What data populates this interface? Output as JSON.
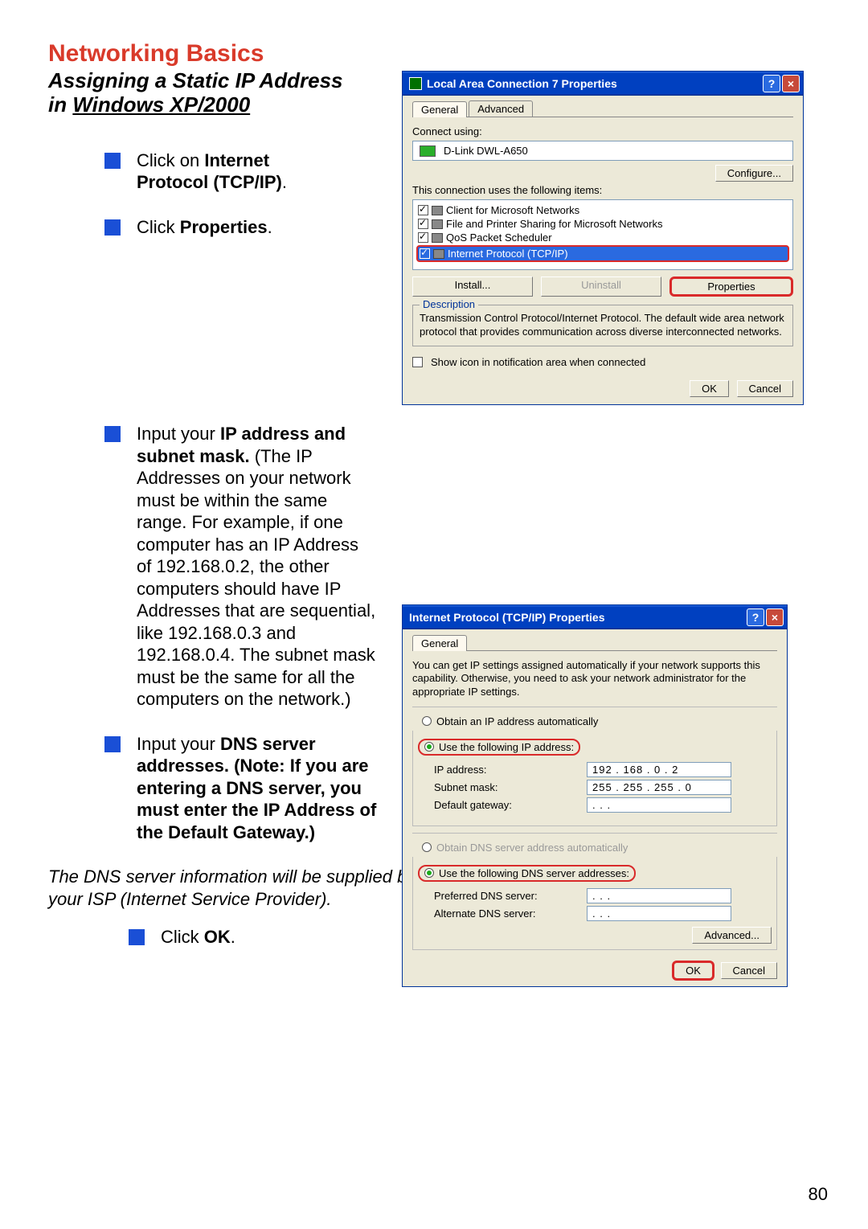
{
  "heading_main": "Networking Basics",
  "heading_sub_line1": "Assigning a Static IP Address",
  "heading_sub_prefix": "in ",
  "heading_sub_underline": "Windows XP/2000",
  "step1_prefix": "Click on ",
  "step1_bold": "Internet Protocol (TCP/IP)",
  "step1_suffix": ".",
  "step2_prefix": "Click ",
  "step2_bold": "Properties",
  "step2_suffix": ".",
  "step3_prefix": "Input your ",
  "step3_bold": "IP address and subnet mask.",
  "step3_rest": " (The IP Addresses on your network must be within the same range. For example, if one computer has an IP Address of 192.168.0.2, the other computers should have IP Addresses that are sequential, like 192.168.0.3 and 192.168.0.4. The subnet mask must be the same for all the computers on the network.)",
  "step4_prefix": "Input your ",
  "step4_bold": "DNS server addresses. (Note:  If you are entering a DNS server, you must enter the IP Address of the Default Gateway.)",
  "dns_note": "The DNS server information will be supplied by your ISP (Internet Service Provider).",
  "step5_prefix": "Click ",
  "step5_bold": "OK",
  "step5_suffix": ".",
  "page_number": "80",
  "dlg1": {
    "title": "Local Area Connection 7 Properties",
    "tabs": {
      "general": "General",
      "advanced": "Advanced"
    },
    "connect_using_label": "Connect using:",
    "adapter": "D-Link DWL-A650",
    "configure_btn": "Configure...",
    "items_label": "This connection uses the following items:",
    "items": [
      "Client for Microsoft Networks",
      "File and Printer Sharing for Microsoft Networks",
      "QoS Packet Scheduler",
      "Internet Protocol (TCP/IP)"
    ],
    "install_btn": "Install...",
    "uninstall_btn": "Uninstall",
    "properties_btn": "Properties",
    "desc_legend": "Description",
    "desc_text": "Transmission Control Protocol/Internet Protocol. The default wide area network protocol that provides communication across diverse interconnected networks.",
    "show_icon": "Show icon in notification area when connected",
    "ok": "OK",
    "cancel": "Cancel"
  },
  "dlg2": {
    "title": "Internet Protocol (TCP/IP) Properties",
    "tab": "General",
    "intro": "You can get IP settings assigned automatically if your network supports this capability. Otherwise, you need to ask your network administrator for the appropriate IP settings.",
    "obtain_ip": "Obtain an IP address automatically",
    "use_ip": "Use the following IP address:",
    "ip_label": "IP address:",
    "ip_value": "192 . 168 .  0  .  2",
    "subnet_label": "Subnet mask:",
    "subnet_value": "255 . 255 . 255 .  0",
    "gateway_label": "Default gateway:",
    "gateway_value": " .      .      . ",
    "obtain_dns": "Obtain DNS server address automatically",
    "use_dns": "Use the following DNS server addresses:",
    "pref_dns_label": "Preferred DNS server:",
    "pref_dns_value": " .      .      . ",
    "alt_dns_label": "Alternate DNS server:",
    "alt_dns_value": " .      .      . ",
    "advanced_btn": "Advanced...",
    "ok": "OK",
    "cancel": "Cancel"
  }
}
